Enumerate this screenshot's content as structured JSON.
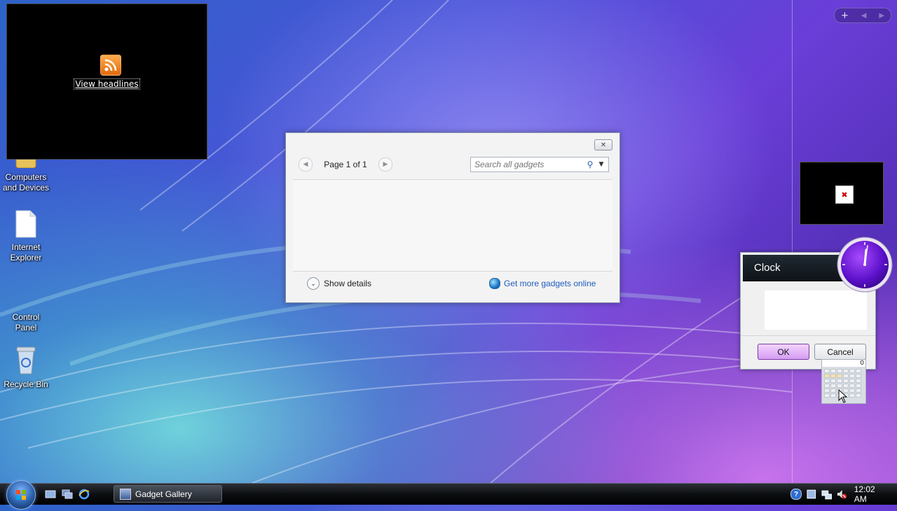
{
  "desktop": {
    "icons": [
      {
        "label": "Computers\nand Devices",
        "icon": "folder-icon"
      },
      {
        "label": "Internet\nExplorer",
        "icon": "blank-file-icon"
      },
      {
        "label": "Control\nPanel",
        "icon": "control-panel-icon"
      },
      {
        "label": "Recycle Bin",
        "icon": "recycle-bin-icon"
      }
    ]
  },
  "feed_gadget": {
    "link_text": "View headlines",
    "icon": "rss-feed-icon"
  },
  "gadget_gallery": {
    "page_label": "Page 1 of 1",
    "search_placeholder": "Search all gadgets",
    "show_details": "Show details",
    "more_link": "Get more gadgets online",
    "close_icon": "close-icon"
  },
  "sidebar": {
    "add_label": "+",
    "prev_label": "◀",
    "next_label": "▶"
  },
  "clock_dialog": {
    "title": "Clock",
    "ok_label": "OK",
    "cancel_label": "Cancel"
  },
  "calculator": {
    "display": "0"
  },
  "taskbar": {
    "window_button": "Gadget Gallery",
    "time": "12:02 AM",
    "help_label": "?"
  },
  "colors": {
    "accent_purple": "#7b3aa7",
    "link_blue": "#1f5cbf"
  }
}
